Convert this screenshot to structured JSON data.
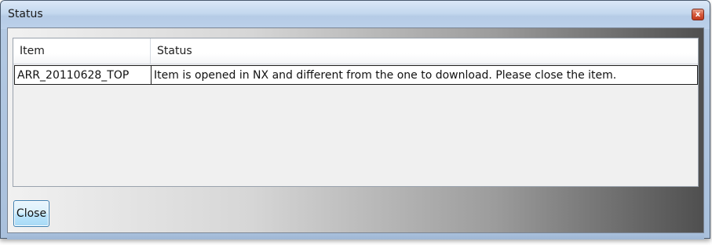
{
  "window": {
    "title": "Status",
    "close_glyph": "x"
  },
  "grid": {
    "columns": [
      "Item",
      "Status"
    ],
    "rows": [
      {
        "item": "ARR_20110628_TOP",
        "status": "Item is opened in NX and different from the one to download. Please close the item."
      }
    ]
  },
  "buttons": {
    "close_label": "Close"
  },
  "colors": {
    "titlebar": "#c3d7ee",
    "close_button_accent": "#d65a3c",
    "focus_button_border": "#3c7fb1"
  }
}
